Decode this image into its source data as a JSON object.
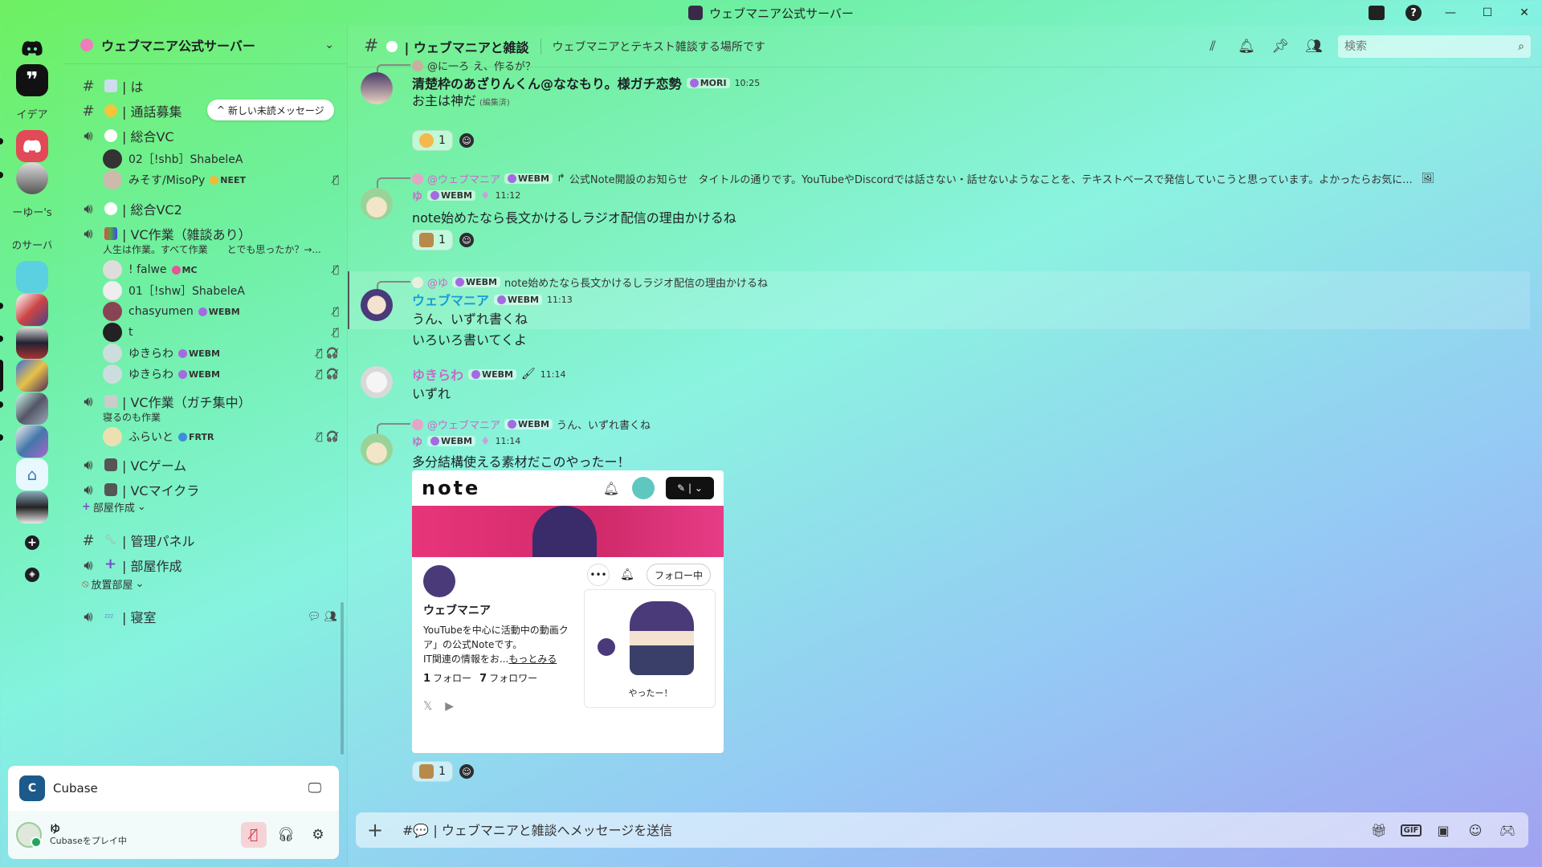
{
  "window": {
    "title": "ウェブマニア公式サーバー"
  },
  "rail": {
    "text_servers": [
      "イデア",
      "ーゆー's",
      "のサーバ"
    ]
  },
  "server": {
    "name": "ウェブマニア公式サーバー"
  },
  "unread_pill": "新しい未読メッセージ",
  "channels": {
    "c0": "| は",
    "c1": "| 通話募集",
    "c2": "| 総合VC",
    "c3": "| 総合VC2",
    "c4": "| VC作業（雑談あり）",
    "c4_sub": "人生は作業。すべて作業　　とでも思ったか？→...",
    "c5": "| VC作業（ガチ集中）",
    "c5_sub": "寝るのも作業",
    "c6": "| VCゲーム",
    "c7": "| VCマイクラ",
    "cat1": "部屋作成",
    "c8": "| 管理パネル",
    "c9": "| 部屋作成",
    "cat2": "放置部屋",
    "c10": "| 寝室"
  },
  "voice_users": [
    {
      "name": "02［!shb］ShabeleA",
      "tag": ""
    },
    {
      "name": "みそす/MisoPy",
      "tag": "NEET"
    },
    {
      "name": "! falwe",
      "tag": "MC"
    },
    {
      "name": "01［!shw］ShabeleA",
      "tag": ""
    },
    {
      "name": "chasyumen",
      "tag": "WEBM"
    },
    {
      "name": "t",
      "tag": ""
    },
    {
      "name": "ゆきらわ",
      "tag": "WEBM"
    },
    {
      "name": "ゆきらわ",
      "tag": "WEBM"
    },
    {
      "name": "ふらいと",
      "tag": "FRTR"
    }
  ],
  "activity": {
    "name": "Cubase"
  },
  "user": {
    "name": "ゆ",
    "status": "Cubaseをプレイ中"
  },
  "chat": {
    "channel": "| ウェブマニアと雑談",
    "topic": "ウェブマニアとテキスト雑談する場所です",
    "search_placeholder": "検索",
    "composer_placeholder": "#💬 | ウェブマニアと雑談へメッセージを送信"
  },
  "messages": [
    {
      "reply_name": "@に一ろ",
      "reply_text": "え、作るが？",
      "name": "清楚枠のあざりんくん@ななもり。様ガチ恋勢",
      "role": "MORI",
      "time": "10:25",
      "text": "お主は神だ",
      "edited": "(編集済)",
      "reaction_count": "1"
    },
    {
      "reply_name": "@ウェブマニア",
      "reply_role": "WEBM",
      "reply_text": "公式Note開設のお知らせ　タイトルの通りです。YouTubeやDiscordでは話さない・話せないようなことを、テキストベースで発信していこうと思っています。よかったらお気に...",
      "name": "ゆ",
      "role": "WEBM",
      "time": "11:12",
      "text": "note始めたなら長文かけるしラジオ配信の理由かけるね",
      "reaction_count": "1"
    },
    {
      "reply_name": "@ゆ",
      "reply_role": "WEBM",
      "reply_text": "note始めたなら長文かけるしラジオ配信の理由かけるね",
      "name": "ウェブマニア",
      "role": "WEBM",
      "time": "11:13",
      "text": "うん、いずれ書くね",
      "text2": "いろいろ書いてくよ"
    },
    {
      "name": "ゆきらわ",
      "role": "WEBM",
      "time": "11:14",
      "text": "いずれ"
    },
    {
      "reply_name": "@ウェブマニア",
      "reply_role": "WEBM",
      "reply_text": "うん、いずれ書くね",
      "name": "ゆ",
      "role": "WEBM",
      "time": "11:14",
      "text": "多分結構使える素材だこのやったー！",
      "reaction_count": "1"
    }
  ],
  "embed": {
    "logo": "note",
    "follow_button": "フォロー中",
    "profile_name": "ウェブマニア",
    "desc1": "YouTubeを中心に活動中の動画ク",
    "desc2": "ア」の公式Noteです。",
    "desc3": "IT関連の情報をお...",
    "more": "もっとみる",
    "following_count": "1",
    "following_label": "フォロー",
    "followers_count": "7",
    "followers_label": "フォロワー",
    "card_caption": "やったー！"
  },
  "colors": {
    "accent_purple": "#a46be0",
    "name_blue": "#1a9bd8",
    "name_pink": "#c86ac8"
  }
}
